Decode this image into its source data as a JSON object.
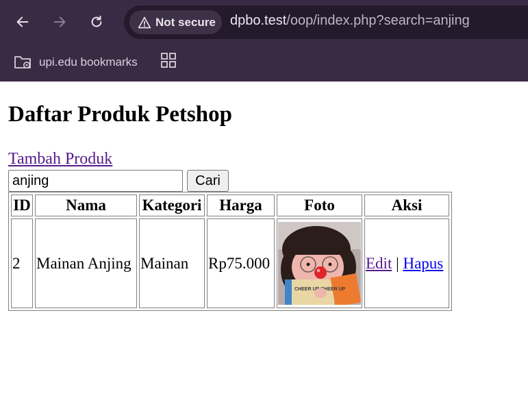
{
  "browser": {
    "security_label": "Not secure",
    "url_host": "dpbo.test",
    "url_path": "/oop/index.php?search=anjing",
    "bookmark_folder_label": "upi.edu bookmarks",
    "icons": {
      "back": "back-arrow-icon",
      "forward": "forward-arrow-icon",
      "reload": "reload-icon",
      "warning": "warning-icon",
      "folder": "folder-settings-icon",
      "apps": "apps-grid-icon"
    }
  },
  "page": {
    "title": "Daftar Produk Petshop",
    "add_link": "Tambah Produk",
    "search": {
      "value": "anjing",
      "button_label": "Cari"
    },
    "table": {
      "headers": [
        "ID",
        "Nama",
        "Kategori",
        "Harga",
        "Foto",
        "Aksi"
      ],
      "rows": [
        {
          "id": "2",
          "nama": "Mainan Anjing",
          "kategori": "Mainan",
          "harga": "Rp75.000",
          "photo_book_text": "CHEER UP CHEER UP",
          "edit_label": "Edit",
          "separator": "|",
          "hapus_label": "Hapus"
        }
      ]
    }
  }
}
